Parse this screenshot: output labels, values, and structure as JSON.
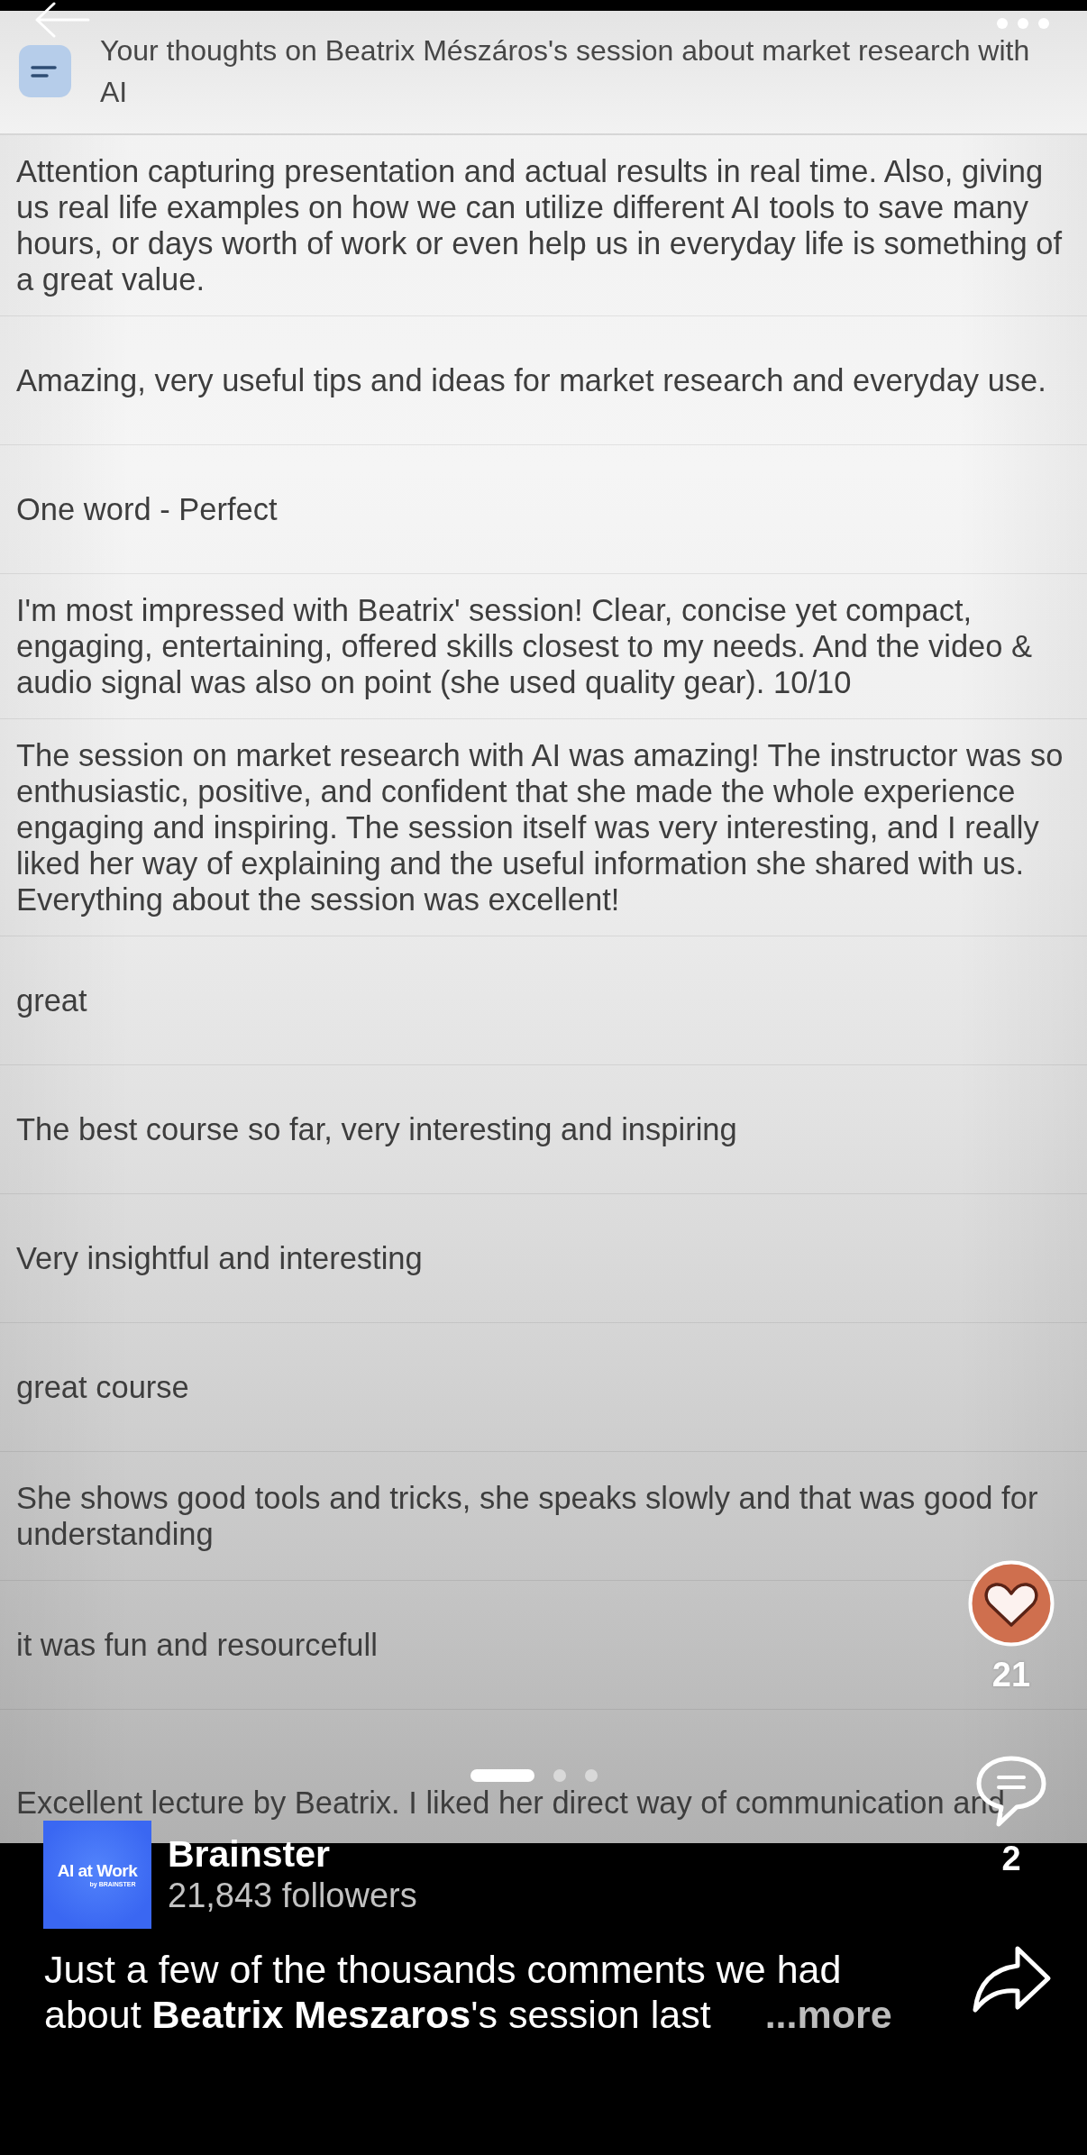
{
  "form": {
    "title": "Your thoughts on Beatrix Mészáros's session about market research with AI",
    "responses": [
      "Attention capturing presentation and actual results in real time. Also, giving us real life examples on how we can utilize different AI tools to save many hours, or days worth of work or even help us in everyday life is something of a great value.",
      "Amazing, very useful tips and ideas for market research and everyday use.",
      "One word - Perfect",
      "I'm most impressed with Beatrix' session! Clear, concise yet compact, engaging, entertaining, offered skills closest to my needs. And the video & audio signal was also on point (she used quality gear). 10/10",
      "The session on market research with AI was amazing! The instructor was so enthusiastic, positive, and confident that she made the whole experience engaging and inspiring. The session itself was very interesting, and I really liked her way of explaining and the useful information she shared with us. Everything about the session was excellent!",
      "great",
      "The best course so far, very interesting and inspiring",
      "Very insightful and interesting",
      "great course",
      "She shows good tools and tricks, she speaks slowly and that was good for understanding",
      "it was fun and resourcefull",
      "Excellent lecture by Beatrix. I liked her direct way of communication and"
    ]
  },
  "pager": [
    {
      "selected": true
    },
    {
      "selected": false
    },
    {
      "selected": false
    }
  ],
  "actions": {
    "likes": "21",
    "comments": "2"
  },
  "post": {
    "logo": {
      "title": "AI at Work",
      "byline": "by BRAINSTER"
    },
    "author": "Brainster",
    "followers": "21,843 followers",
    "caption": "Just a few of the thousands comments we had about **Beatrix Meszaros**'s session last",
    "more": "...more"
  }
}
